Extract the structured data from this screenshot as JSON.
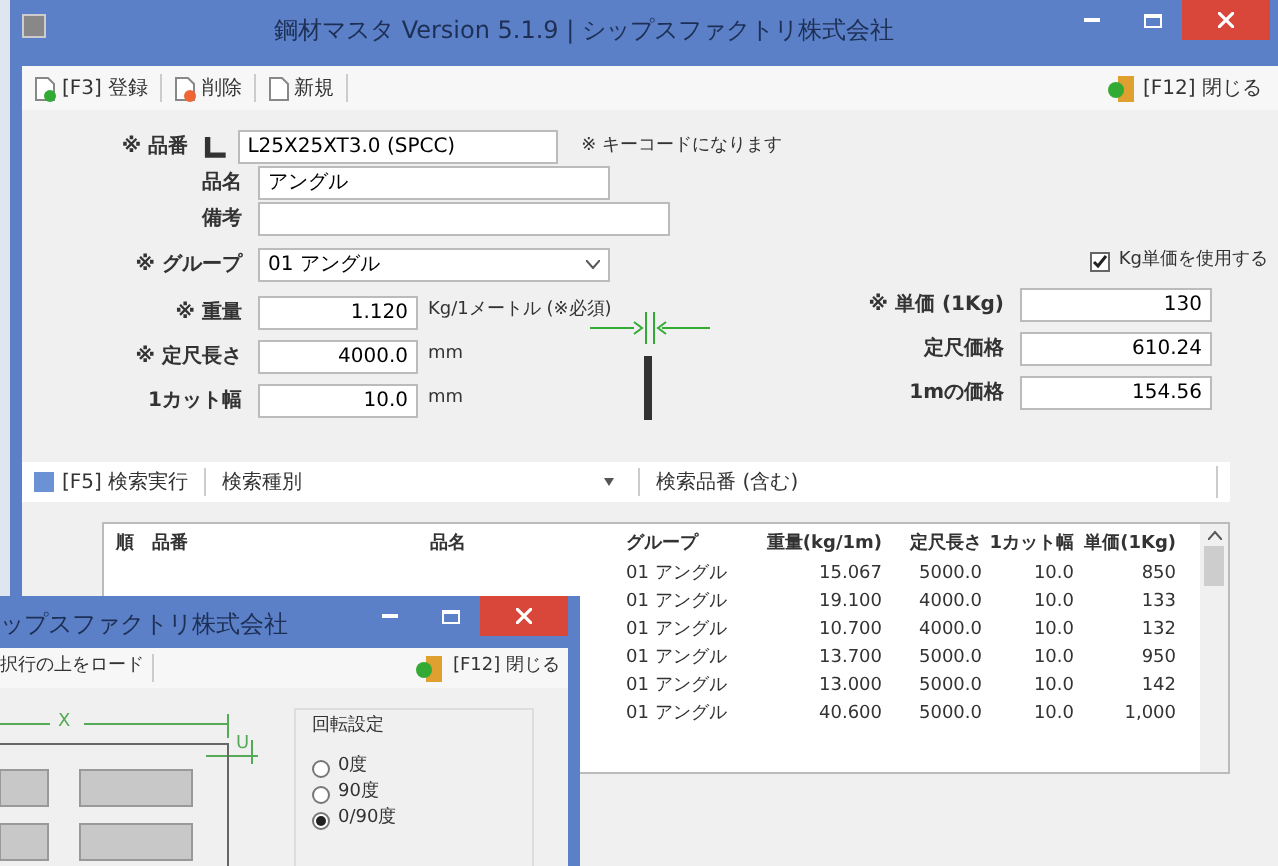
{
  "window": {
    "title": "鋼材マスタ Version 5.1.9 | シップスファクトリ株式会社"
  },
  "toolbar": {
    "buttons": [
      {
        "label": "[F3] 登録",
        "kind": "save"
      },
      {
        "label": "削除",
        "kind": "delete"
      },
      {
        "label": "新規",
        "kind": "new"
      }
    ],
    "close": "[F12] 閉じる"
  },
  "form": {
    "item_code": {
      "label": "※ 品番",
      "value": "L25X25XT3.0 (SPCC)",
      "note": "※ キーコードになります"
    },
    "item_name": {
      "label": "品名",
      "value": "アングル"
    },
    "remarks": {
      "label": "備考"
    },
    "group": {
      "label": "※ グループ",
      "value": "01 アングル"
    },
    "use_kg_price": {
      "label": "Kg単価を使用する",
      "checked": true
    },
    "weight": {
      "label": "※ 重量",
      "value": "1.120",
      "unit": "Kg/1メートル (※必須)"
    },
    "unit_price": {
      "label": "※ 単価 (1Kg)",
      "value": "130"
    },
    "length": {
      "label": "※ 定尺長さ",
      "value": "4000.0",
      "unit": "mm"
    },
    "length_price": {
      "label": "定尺価格",
      "value": "610.24"
    },
    "cut_width": {
      "label": "1カット幅",
      "value": "10.0",
      "unit": "mm"
    },
    "meter_price": {
      "label": "1mの価格",
      "value": "154.56"
    }
  },
  "search": {
    "button": "[F5] 検索実行",
    "type_label": "検索種別",
    "code_label": "検索品番 (含む)"
  },
  "table": {
    "columns": [
      "順",
      "品番",
      "品名",
      "グループ",
      "重量(kg/1m)",
      "定尺長さ",
      "1カット幅",
      "単価(1Kg)"
    ],
    "rows": [
      {
        "group": "01 アングル",
        "weight": "15.067",
        "length": "5000.0",
        "cut": "10.0",
        "price": "850"
      },
      {
        "group": "01 アングル",
        "weight": "19.100",
        "length": "4000.0",
        "cut": "10.0",
        "price": "133"
      },
      {
        "group": "01 アングル",
        "weight": "10.700",
        "length": "4000.0",
        "cut": "10.0",
        "price": "132"
      },
      {
        "group": "01 アングル",
        "weight": "13.700",
        "length": "5000.0",
        "cut": "10.0",
        "price": "950"
      },
      {
        "group": "01 アングル",
        "weight": "13.000",
        "length": "5000.0",
        "cut": "10.0",
        "price": "142"
      },
      {
        "group": "01 アングル",
        "weight": "40.600",
        "length": "5000.0",
        "cut": "10.0",
        "price": "1,000"
      }
    ]
  },
  "second_window": {
    "title": "ップスファクトリ株式会社",
    "load_button": "択行の上をロード",
    "close": "[F12] 閉じる",
    "dim_x": "X",
    "dim_u": "U",
    "rotation": {
      "title": "回転設定",
      "options": [
        {
          "label": "0度",
          "selected": false
        },
        {
          "label": "90度",
          "selected": false
        },
        {
          "label": "0/90度",
          "selected": true
        }
      ]
    }
  }
}
